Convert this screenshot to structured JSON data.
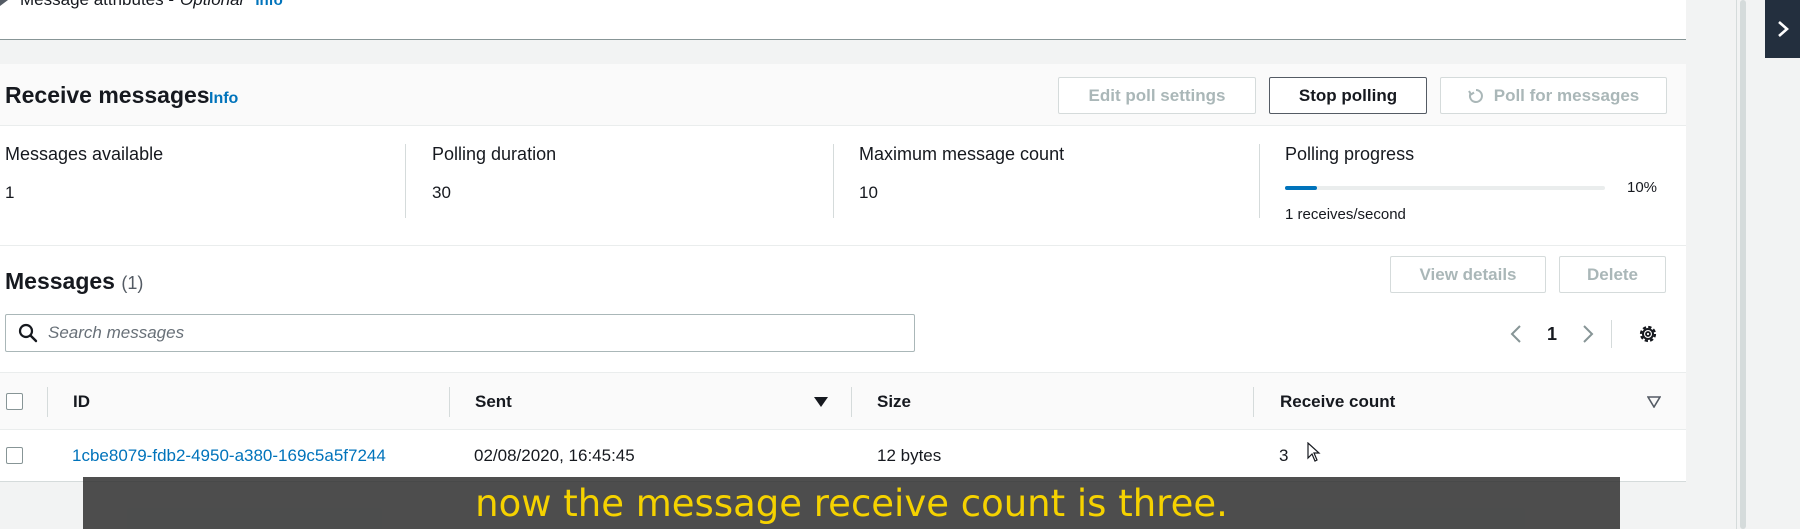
{
  "message_attributes": {
    "label": "Message attributes - ",
    "optional": "Optional",
    "info": "Info"
  },
  "receive": {
    "title": "Receive messages",
    "info": "Info",
    "buttons": {
      "edit_poll_settings": "Edit poll settings",
      "stop_polling": "Stop polling",
      "poll_for_messages": "Poll for messages"
    },
    "stats": {
      "messages_available_label": "Messages available",
      "messages_available_value": "1",
      "polling_duration_label": "Polling duration",
      "polling_duration_value": "30",
      "max_message_count_label": "Maximum message count",
      "max_message_count_value": "10",
      "polling_progress_label": "Polling progress",
      "polling_progress_pct": "10%",
      "polling_progress_fraction": 0.1,
      "polling_rate": "1 receives/second"
    }
  },
  "messages": {
    "title": "Messages",
    "count": "(1)",
    "buttons": {
      "view_details": "View details",
      "delete": "Delete"
    },
    "search_placeholder": "Search messages",
    "page": "1",
    "columns": [
      "ID",
      "Sent",
      "Size",
      "Receive count"
    ],
    "rows": [
      {
        "id": "1cbe8079-fdb2-4950-a380-169c5a5f7244",
        "sent": "02/08/2020, 16:45:45",
        "size": "12 bytes",
        "receive_count": "3"
      }
    ]
  },
  "caption": "now the message receive count is three.",
  "colors": {
    "link": "#0073bb",
    "caption_text": "#f5d200",
    "side_toggle": "#232f3e"
  }
}
